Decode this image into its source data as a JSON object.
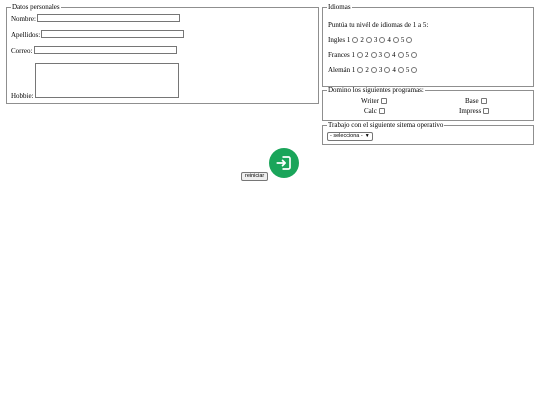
{
  "datos": {
    "legend": "Datos personales",
    "nombre_label": "Nombre:",
    "nombre_value": "",
    "apellidos_label": "Apellidos:",
    "apellidos_value": "",
    "correo_label": "Correo:",
    "correo_value": "",
    "hobbie_label": "Hobbie:",
    "hobbie_value": ""
  },
  "idiomas": {
    "legend": "Idiomas",
    "prompt": "Puntúa tu nivél de idiomas de 1 a 5:",
    "rows": [
      {
        "label": "Ingles",
        "options": [
          "1",
          "2",
          "3",
          "4",
          "5"
        ]
      },
      {
        "label": "Frances",
        "options": [
          "1",
          "2",
          "3",
          "4",
          "5"
        ]
      },
      {
        "label": "Alemán",
        "options": [
          "1",
          "2",
          "3",
          "4",
          "5"
        ]
      }
    ]
  },
  "programas": {
    "legend": "Domino los siguientes programas:",
    "items": [
      "Writer",
      "Base",
      "Calc",
      "Impress"
    ]
  },
  "sistema": {
    "legend": "Trabajo con el siguiente sitema operativo",
    "select_value": "- selecciona -"
  },
  "actions": {
    "reset_label": "reiniciar",
    "submit_icon": "login-icon",
    "accent_color": "#1aa55a"
  }
}
